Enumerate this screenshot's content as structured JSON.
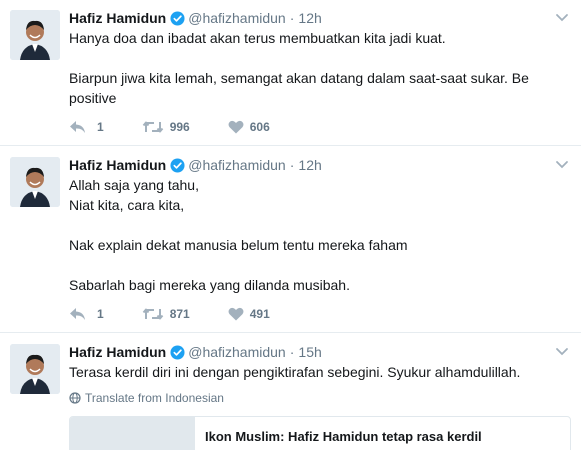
{
  "tweets": [
    {
      "name": "Hafiz Hamidun",
      "handle": "@hafizhamidun",
      "dot": "·",
      "time": "12h",
      "paragraphs": [
        "Hanya doa dan ibadat akan terus membuatkan kita jadi kuat.",
        "Biarpun jiwa kita lemah, semangat akan datang dalam saat-saat sukar. Be positive"
      ],
      "reply_count": "1",
      "retweet_count": "996",
      "like_count": "606"
    },
    {
      "name": "Hafiz Hamidun",
      "handle": "@hafizhamidun",
      "dot": "·",
      "time": "12h",
      "paragraphs": [
        "Allah saja yang tahu,",
        "Niat kita, cara kita,",
        "Nak explain dekat manusia belum tentu mereka faham",
        "Sabarlah bagi mereka yang dilanda musibah."
      ],
      "reply_count": "1",
      "retweet_count": "871",
      "like_count": "491"
    },
    {
      "name": "Hafiz Hamidun",
      "handle": "@hafizhamidun",
      "dot": "·",
      "time": "15h",
      "paragraphs": [
        "Terasa kerdil diri ini dengan pengiktirafan sebegini. Syukur alhamdulillah."
      ],
      "translate": "Translate from Indonesian",
      "card_title": "Ikon Muslim: Hafiz Hamidun tetap rasa kerdil"
    }
  ],
  "icons": {
    "verified": "verified-badge-icon",
    "caret": "chevron-down-icon",
    "reply": "reply-icon",
    "retweet": "retweet-icon",
    "like": "heart-icon",
    "globe": "globe-icon"
  },
  "colors": {
    "verified": "#1da1f2",
    "muted": "#657786",
    "text": "#14171a",
    "divider": "#e6ecf0"
  }
}
